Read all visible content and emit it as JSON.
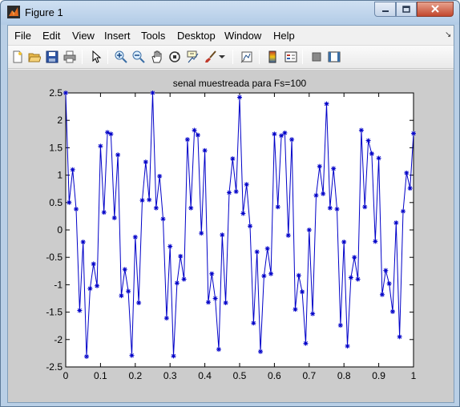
{
  "window": {
    "title": "Figure 1"
  },
  "menu": [
    "File",
    "Edit",
    "View",
    "Insert",
    "Tools",
    "Desktop",
    "Window",
    "Help"
  ],
  "toolbar_icons": [
    "new-figure-icon",
    "open-file-icon",
    "save-icon",
    "print-icon",
    "pointer-icon",
    "zoom-in-icon",
    "zoom-out-icon",
    "pan-hand-icon",
    "rotate-3d-icon",
    "data-cursor-icon",
    "brush-icon",
    "brush-dropdown-icon",
    "link-plot-icon",
    "colorbar-icon",
    "legend-icon",
    "hide-plot-tools-icon",
    "show-plot-tools-icon"
  ],
  "colors": {
    "series": "#0000c8",
    "figure_bg": "#cccccc",
    "axes_bg": "#ffffff"
  },
  "chart_data": {
    "type": "line",
    "title": "senal muestreada para Fs=100",
    "xlabel": "",
    "ylabel": "",
    "xlim": [
      0,
      1
    ],
    "ylim": [
      -2.5,
      2.5
    ],
    "xticks": [
      "0",
      "0.1",
      "0.2",
      "0.3",
      "0.4",
      "0.5",
      "0.6",
      "0.7",
      "0.8",
      "0.9",
      "1"
    ],
    "yticks": [
      "2.5",
      "2",
      "1.5",
      "1",
      "0.5",
      "0",
      "-0.5",
      "-1",
      "-1.5",
      "-2",
      "-2.5"
    ],
    "marker": "*",
    "grid": false,
    "series": [
      {
        "x": [
          0.0,
          0.01,
          0.02,
          0.03,
          0.04,
          0.05,
          0.06,
          0.07,
          0.08,
          0.09,
          0.1,
          0.11,
          0.12,
          0.13,
          0.14,
          0.15,
          0.16,
          0.17,
          0.18,
          0.19,
          0.2,
          0.21,
          0.22,
          0.23,
          0.24,
          0.25,
          0.26,
          0.27,
          0.28,
          0.29,
          0.3,
          0.31,
          0.32,
          0.33,
          0.34,
          0.35,
          0.36,
          0.37,
          0.38,
          0.39,
          0.4,
          0.41,
          0.42,
          0.43,
          0.44,
          0.45,
          0.46,
          0.47,
          0.48,
          0.49,
          0.5,
          0.51,
          0.52,
          0.53,
          0.54,
          0.55,
          0.56,
          0.57,
          0.58,
          0.59,
          0.6,
          0.61,
          0.62,
          0.63,
          0.64,
          0.65,
          0.66,
          0.67,
          0.68,
          0.69,
          0.7,
          0.71,
          0.72,
          0.73,
          0.74,
          0.75,
          0.76,
          0.77,
          0.78,
          0.79,
          0.8,
          0.81,
          0.82,
          0.83,
          0.84,
          0.85,
          0.86,
          0.87,
          0.88,
          0.89,
          0.9,
          0.91,
          0.92,
          0.93,
          0.94,
          0.95,
          0.96,
          0.97,
          0.98,
          0.99,
          1.0
        ],
        "y": [
          2.5,
          0.5,
          1.1,
          0.38,
          -1.47,
          -0.22,
          -2.31,
          -1.07,
          -0.62,
          -1.02,
          1.53,
          0.32,
          1.78,
          1.75,
          0.22,
          1.37,
          -1.2,
          -0.72,
          -1.12,
          -2.29,
          -0.13,
          -1.33,
          0.54,
          1.24,
          0.55,
          2.5,
          0.4,
          0.98,
          0.2,
          -1.61,
          -0.3,
          -2.3,
          -0.97,
          -0.48,
          -0.9,
          1.65,
          0.4,
          1.82,
          1.73,
          -0.06,
          1.45,
          -1.32,
          -0.8,
          -1.25,
          -2.18,
          -0.09,
          -1.33,
          0.68,
          1.3,
          0.7,
          2.42,
          0.3,
          0.83,
          0.07,
          -1.7,
          -0.4,
          -2.22,
          -0.84,
          -0.34,
          -0.8,
          1.75,
          0.42,
          1.72,
          1.77,
          -0.1,
          1.65,
          -1.45,
          -0.83,
          -1.13,
          -2.07,
          0.0,
          -1.53,
          0.63,
          1.16,
          0.66,
          2.3,
          0.4,
          1.12,
          0.38,
          -1.74,
          -0.22,
          -2.12,
          -0.87,
          -0.5,
          -0.9,
          1.82,
          0.42,
          1.63,
          1.39,
          -0.21,
          1.31,
          -1.18,
          -0.74,
          -0.98,
          -1.49,
          0.13,
          -1.95,
          0.34,
          1.04,
          0.76,
          1.76
        ]
      }
    ]
  }
}
